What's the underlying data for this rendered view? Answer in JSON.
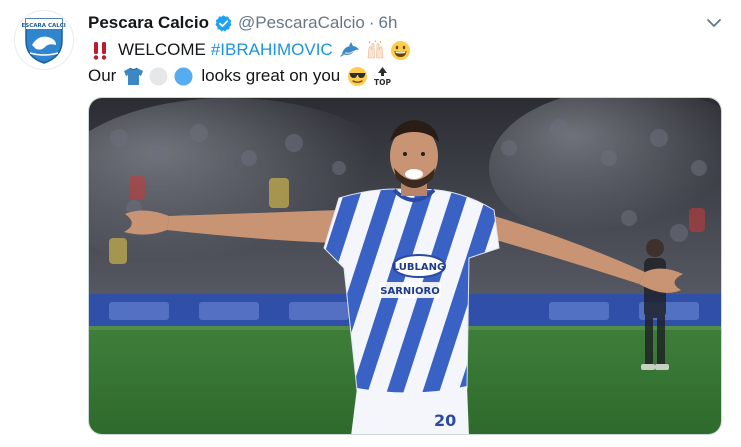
{
  "tweet": {
    "display_name": "Pescara Calcio",
    "handle": "@PescaraCalcio",
    "separator": "·",
    "time": "6h",
    "line1": {
      "word": "WELCOME",
      "hashtag": "#IBRAHIMOVIC"
    },
    "line2": {
      "start": "Our",
      "end": "looks great on you"
    },
    "icons": {
      "verified": "verified-badge-icon",
      "caret": "chevron-down-icon",
      "line1": [
        "double-exclamation-icon",
        "dolphin-icon",
        "raised-hands-icon",
        "grinning-face-icon"
      ],
      "line2": [
        "jersey-icon",
        "white-circle-icon",
        "blue-circle-icon",
        "sunglasses-face-icon",
        "top-arrow-icon"
      ]
    },
    "media": {
      "type": "photo",
      "jersey_sponsors": [
        "LUBLANG",
        "SARNIORO"
      ]
    }
  },
  "colors": {
    "link": "#1b95e0",
    "verified": "#1da1f2",
    "secondary_text": "#657786",
    "club_blue": "#3a8fd8"
  }
}
